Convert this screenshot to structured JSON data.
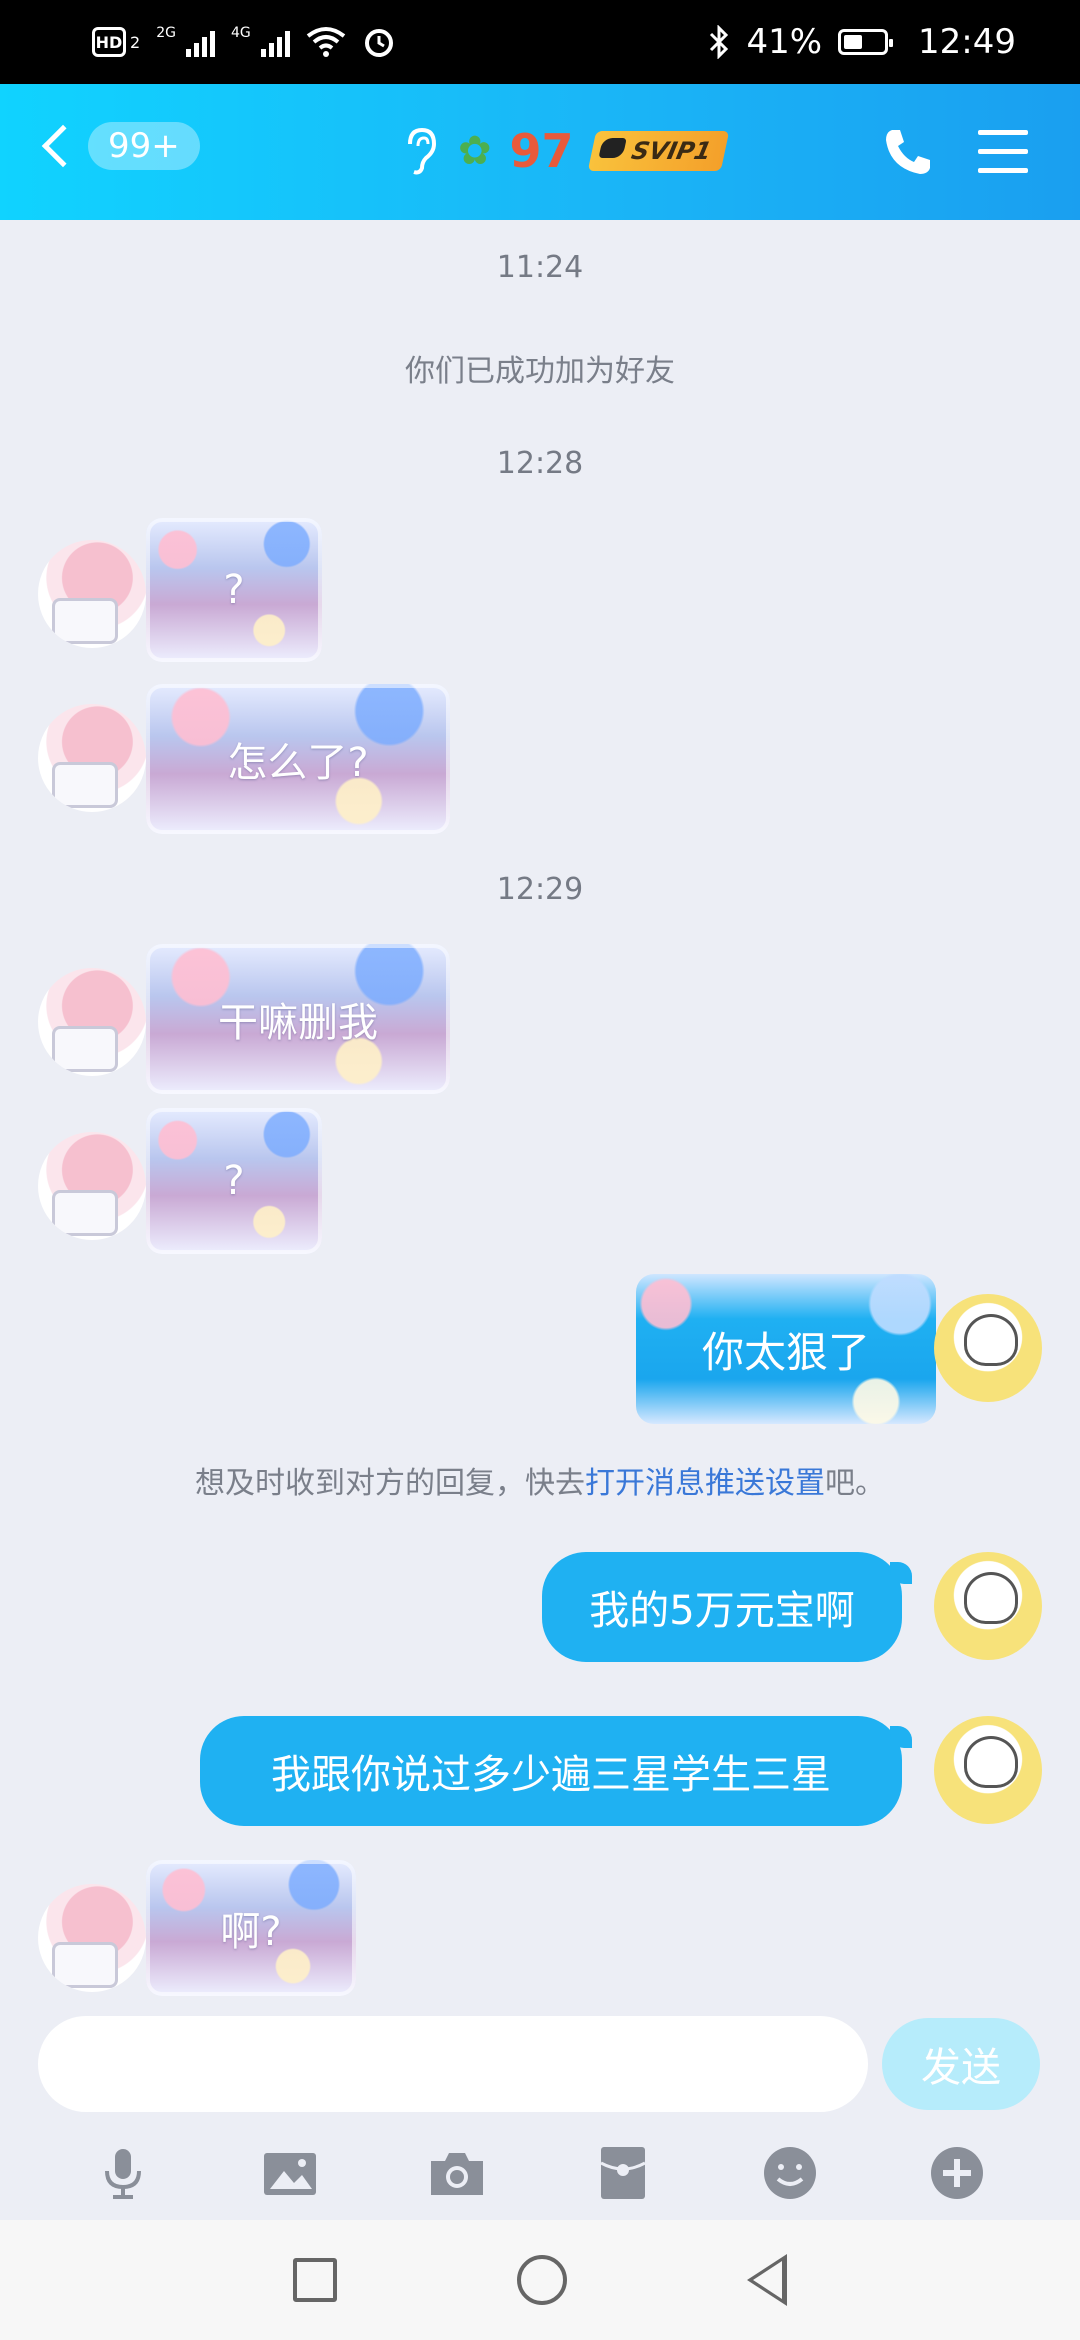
{
  "status_bar": {
    "hd_label": "HD",
    "sim2_label": "2",
    "net1": "2G",
    "net2": "4G",
    "battery_percent": "41%",
    "time": "12:49"
  },
  "header": {
    "unread_count": "99+",
    "score": "97",
    "vip_label": "SVIP1"
  },
  "chat": {
    "messages": [
      {
        "type": "time",
        "text": "11:24"
      },
      {
        "type": "system",
        "text": "你们已成功加为好友"
      },
      {
        "type": "time",
        "text": "12:28"
      },
      {
        "type": "incoming",
        "text": "?"
      },
      {
        "type": "incoming",
        "text": "怎么了?"
      },
      {
        "type": "time",
        "text": "12:29"
      },
      {
        "type": "incoming",
        "text": "干嘛删我"
      },
      {
        "type": "incoming",
        "text": "?"
      },
      {
        "type": "outgoing",
        "text": "你太狠了"
      },
      {
        "type": "system",
        "text_before": "想及时收到对方的回复，快去",
        "link": "打开消息推送设置",
        "text_after": "吧。"
      },
      {
        "type": "outgoing",
        "text": "我的5万元宝啊"
      },
      {
        "type": "outgoing",
        "text": "我跟你说过多少遍三星学生三星"
      },
      {
        "type": "incoming",
        "text": "啊?"
      }
    ]
  },
  "input": {
    "placeholder": "",
    "send_label": "发送"
  },
  "toolbar": [
    "mic-icon",
    "image-icon",
    "camera-icon",
    "red-packet-icon",
    "emoji-icon",
    "plus-icon"
  ],
  "colors": {
    "header_start": "#10d3ff",
    "header_end": "#1a9ff0",
    "bubble_blue": "#1fb1f2",
    "link": "#3a78d8",
    "background": "#eceef5"
  }
}
